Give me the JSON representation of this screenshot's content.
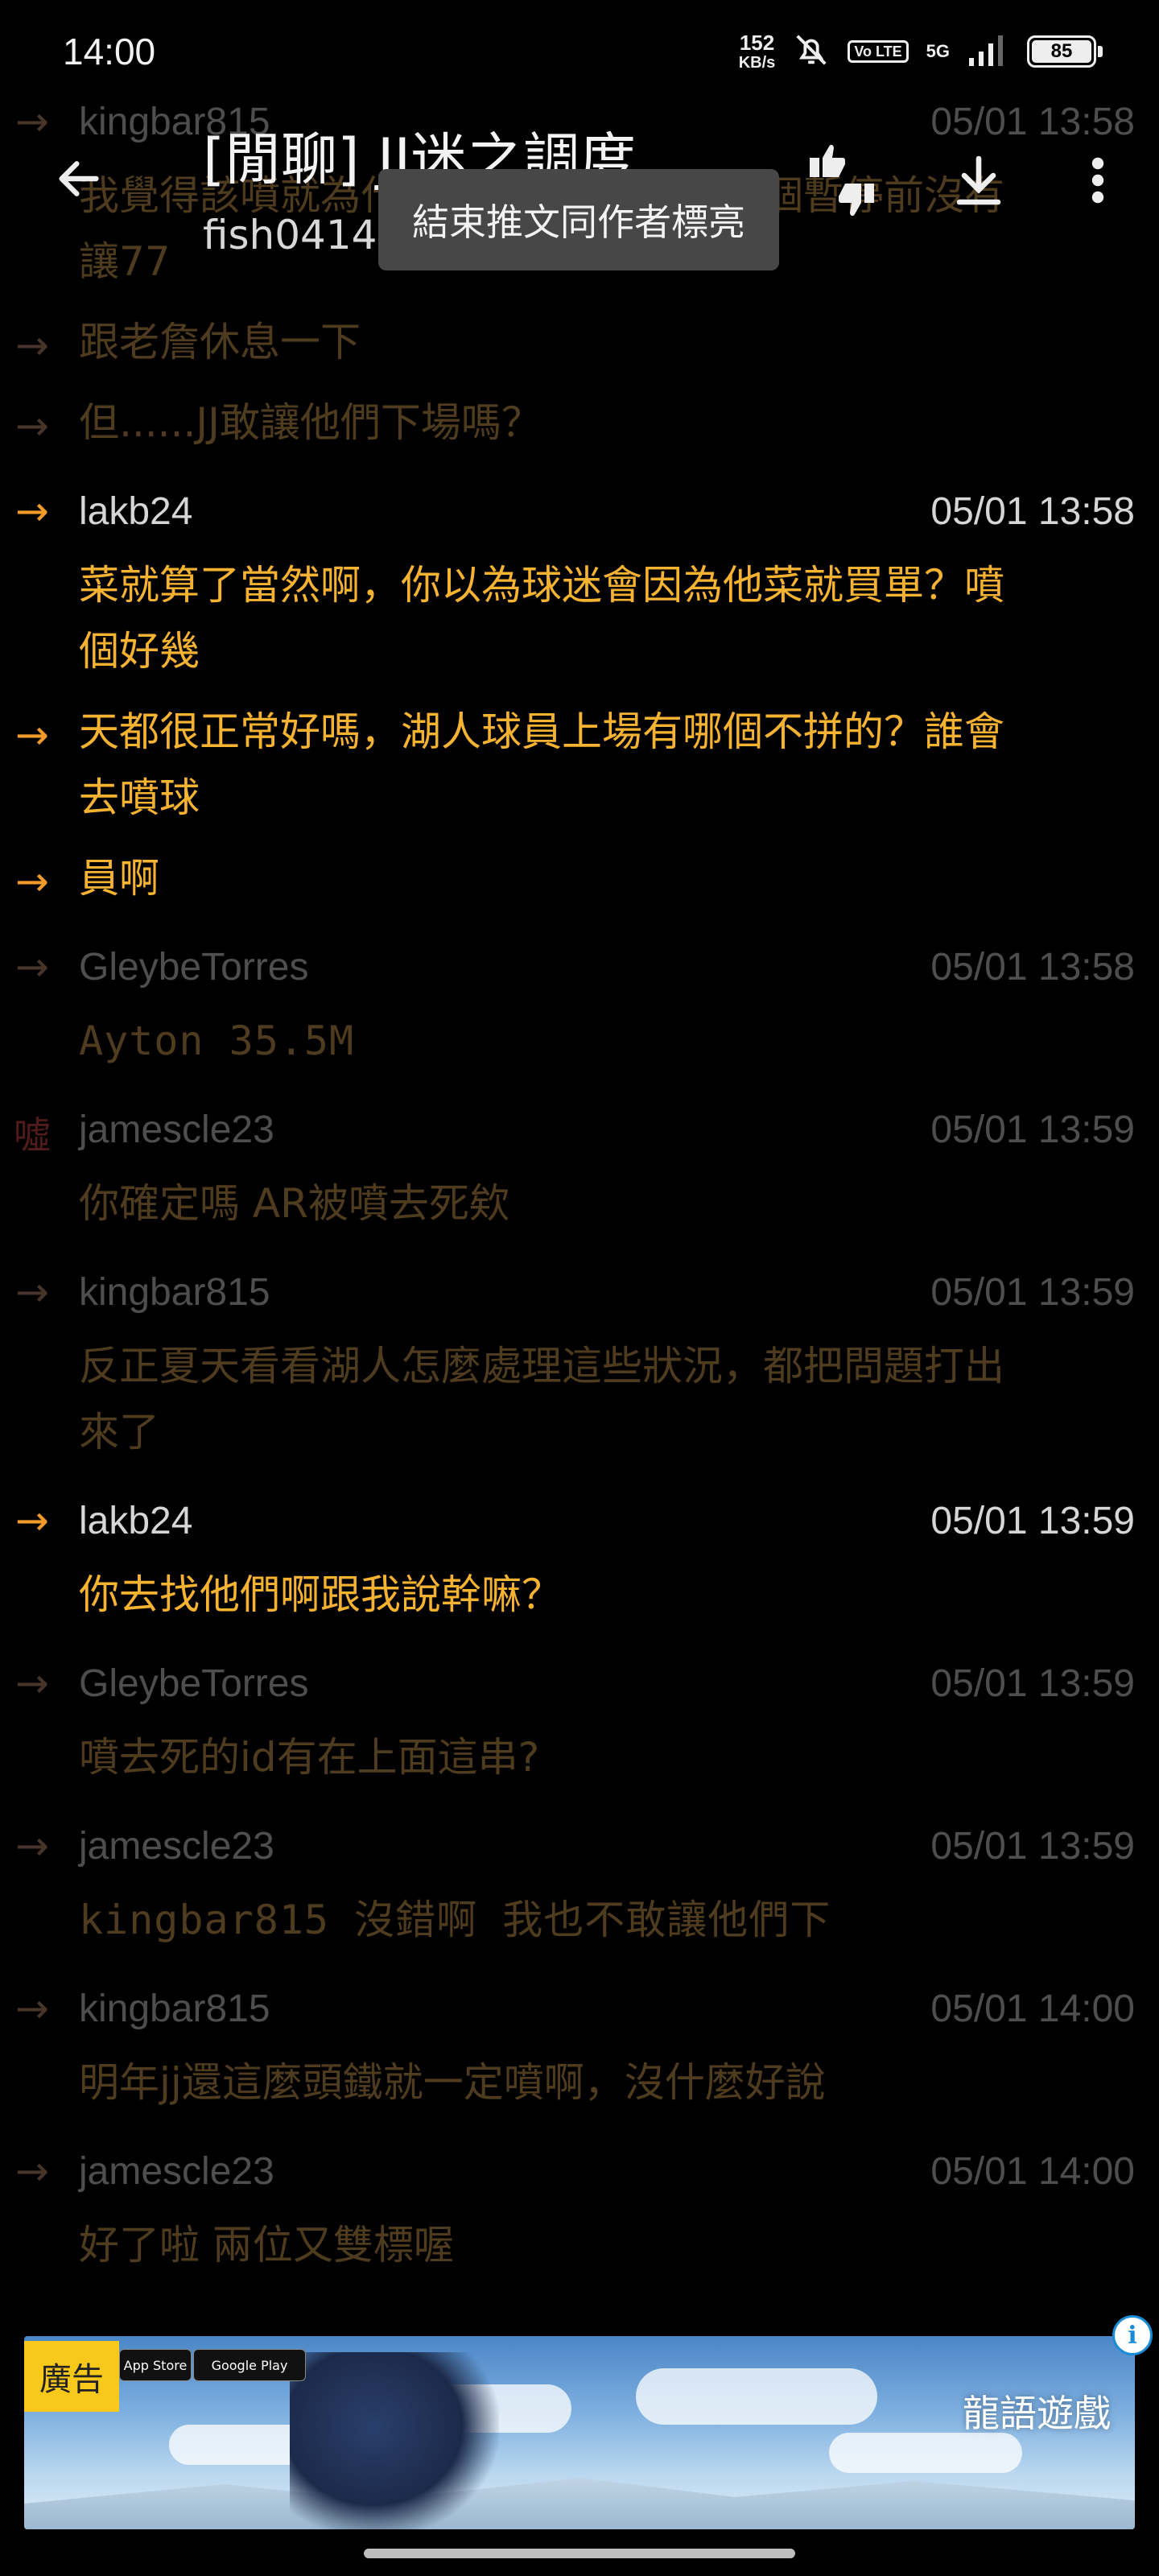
{
  "status_bar": {
    "time": "14:00",
    "net_speed_value": "152",
    "net_speed_unit": "KB/s",
    "volte": "Vo LTE",
    "network": "5G",
    "battery": "85"
  },
  "toolbar": {
    "title": "[閒聊] JJ迷之調度",
    "subtitle": "fish0414 (魚魚吃魚)@Lak...",
    "tooltip": "結束推文同作者標亮"
  },
  "comments": [
    {
      "arrow": "→",
      "style": "dim",
      "user": "kingbar815",
      "time": "05/01 13:58",
      "lines": [
        "我覺得該噴就為什麼上一場第四節第一個暫停前沒有",
        "讓77"
      ]
    },
    {
      "arrow": "→",
      "style": "dim",
      "user": "",
      "time": "",
      "lines": [
        "跟老詹休息一下"
      ]
    },
    {
      "arrow": "→",
      "style": "dim",
      "user": "",
      "time": "",
      "lines": [
        "但......JJ敢讓他們下場嗎？"
      ]
    },
    {
      "arrow": "→",
      "style": "hi",
      "user": "lakb24",
      "time": "05/01 13:58",
      "lines": [
        "菜就算了當然啊，你以為球迷會因為他菜就買單？噴",
        "個好幾"
      ]
    },
    {
      "arrow": "→",
      "style": "hi",
      "user": "",
      "time": "",
      "lines": [
        "天都很正常好嗎，湖人球員上場有哪個不拼的？誰會",
        "去噴球"
      ]
    },
    {
      "arrow": "→",
      "style": "hi",
      "user": "",
      "time": "",
      "lines": [
        "員啊"
      ]
    },
    {
      "arrow": "→",
      "style": "dim",
      "user": "GleybeTorres",
      "time": "05/01 13:58",
      "lines": [
        "Ayton 35.5M"
      ],
      "mono": true
    },
    {
      "arrow": "噓",
      "style": "dim",
      "user": "jamescle23",
      "time": "05/01 13:59",
      "lines": [
        "你確定嗎 AR被噴去死欸"
      ]
    },
    {
      "arrow": "→",
      "style": "dim",
      "user": "kingbar815",
      "time": "05/01 13:59",
      "lines": [
        "反正夏天看看湖人怎麼處理這些狀況，都把問題打出",
        "來了"
      ]
    },
    {
      "arrow": "→",
      "style": "hi",
      "user": "lakb24",
      "time": "05/01 13:59",
      "lines": [
        "你去找他們啊跟我說幹嘛？"
      ]
    },
    {
      "arrow": "→",
      "style": "dim",
      "user": "GleybeTorres",
      "time": "05/01 13:59",
      "lines": [
        "噴去死的id有在上面這串?"
      ]
    },
    {
      "arrow": "→",
      "style": "dim",
      "user": "jamescle23",
      "time": "05/01 13:59",
      "lines": [
        "kingbar815 沒錯啊 我也不敢讓他們下"
      ],
      "mono": true
    },
    {
      "arrow": "→",
      "style": "dim",
      "user": "kingbar815",
      "time": "05/01 14:00",
      "lines": [
        "明年jj還這麼頭鐵就一定噴啊，沒什麼好說"
      ]
    },
    {
      "arrow": "→",
      "style": "dim",
      "user": "jamescle23",
      "time": "05/01 14:00",
      "lines": [
        "好了啦 兩位又雙標喔"
      ]
    }
  ],
  "ad": {
    "label": "廣告",
    "app_store": "App Store",
    "google_play": "Google Play",
    "brand": "龍語遊戲",
    "info": "i"
  },
  "colors": {
    "highlight_text": "#f6b231",
    "dim_text": "#4f3c1f",
    "background": "#000000"
  }
}
